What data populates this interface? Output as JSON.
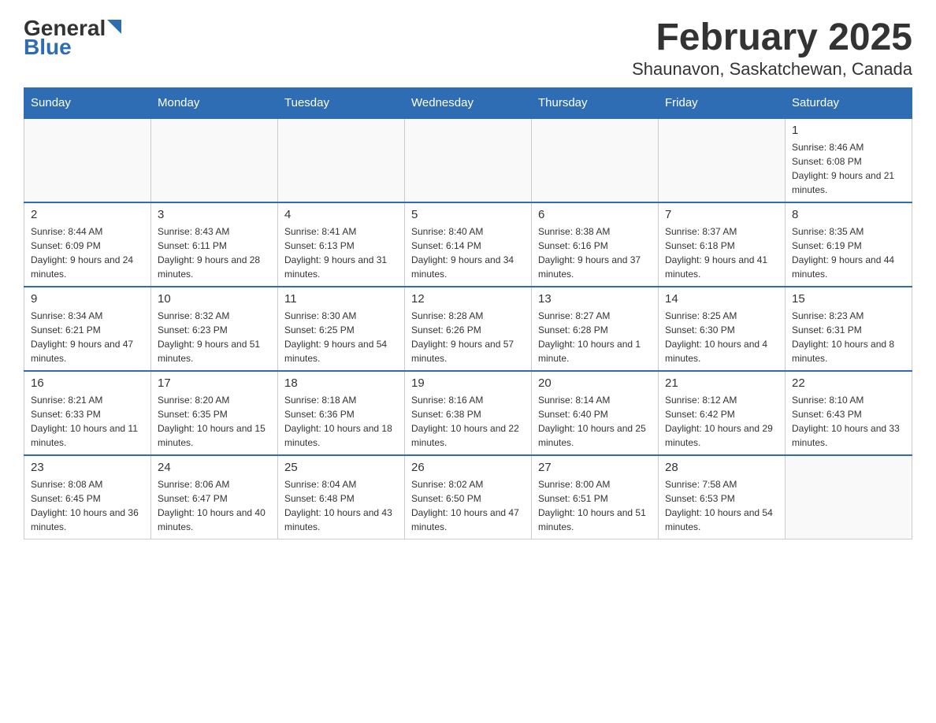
{
  "header": {
    "logo_general": "General",
    "logo_blue": "Blue",
    "title": "February 2025",
    "subtitle": "Shaunavon, Saskatchewan, Canada"
  },
  "days_of_week": [
    "Sunday",
    "Monday",
    "Tuesday",
    "Wednesday",
    "Thursday",
    "Friday",
    "Saturday"
  ],
  "weeks": [
    {
      "days": [
        {
          "num": "",
          "info": ""
        },
        {
          "num": "",
          "info": ""
        },
        {
          "num": "",
          "info": ""
        },
        {
          "num": "",
          "info": ""
        },
        {
          "num": "",
          "info": ""
        },
        {
          "num": "",
          "info": ""
        },
        {
          "num": "1",
          "info": "Sunrise: 8:46 AM\nSunset: 6:08 PM\nDaylight: 9 hours and 21 minutes."
        }
      ]
    },
    {
      "days": [
        {
          "num": "2",
          "info": "Sunrise: 8:44 AM\nSunset: 6:09 PM\nDaylight: 9 hours and 24 minutes."
        },
        {
          "num": "3",
          "info": "Sunrise: 8:43 AM\nSunset: 6:11 PM\nDaylight: 9 hours and 28 minutes."
        },
        {
          "num": "4",
          "info": "Sunrise: 8:41 AM\nSunset: 6:13 PM\nDaylight: 9 hours and 31 minutes."
        },
        {
          "num": "5",
          "info": "Sunrise: 8:40 AM\nSunset: 6:14 PM\nDaylight: 9 hours and 34 minutes."
        },
        {
          "num": "6",
          "info": "Sunrise: 8:38 AM\nSunset: 6:16 PM\nDaylight: 9 hours and 37 minutes."
        },
        {
          "num": "7",
          "info": "Sunrise: 8:37 AM\nSunset: 6:18 PM\nDaylight: 9 hours and 41 minutes."
        },
        {
          "num": "8",
          "info": "Sunrise: 8:35 AM\nSunset: 6:19 PM\nDaylight: 9 hours and 44 minutes."
        }
      ]
    },
    {
      "days": [
        {
          "num": "9",
          "info": "Sunrise: 8:34 AM\nSunset: 6:21 PM\nDaylight: 9 hours and 47 minutes."
        },
        {
          "num": "10",
          "info": "Sunrise: 8:32 AM\nSunset: 6:23 PM\nDaylight: 9 hours and 51 minutes."
        },
        {
          "num": "11",
          "info": "Sunrise: 8:30 AM\nSunset: 6:25 PM\nDaylight: 9 hours and 54 minutes."
        },
        {
          "num": "12",
          "info": "Sunrise: 8:28 AM\nSunset: 6:26 PM\nDaylight: 9 hours and 57 minutes."
        },
        {
          "num": "13",
          "info": "Sunrise: 8:27 AM\nSunset: 6:28 PM\nDaylight: 10 hours and 1 minute."
        },
        {
          "num": "14",
          "info": "Sunrise: 8:25 AM\nSunset: 6:30 PM\nDaylight: 10 hours and 4 minutes."
        },
        {
          "num": "15",
          "info": "Sunrise: 8:23 AM\nSunset: 6:31 PM\nDaylight: 10 hours and 8 minutes."
        }
      ]
    },
    {
      "days": [
        {
          "num": "16",
          "info": "Sunrise: 8:21 AM\nSunset: 6:33 PM\nDaylight: 10 hours and 11 minutes."
        },
        {
          "num": "17",
          "info": "Sunrise: 8:20 AM\nSunset: 6:35 PM\nDaylight: 10 hours and 15 minutes."
        },
        {
          "num": "18",
          "info": "Sunrise: 8:18 AM\nSunset: 6:36 PM\nDaylight: 10 hours and 18 minutes."
        },
        {
          "num": "19",
          "info": "Sunrise: 8:16 AM\nSunset: 6:38 PM\nDaylight: 10 hours and 22 minutes."
        },
        {
          "num": "20",
          "info": "Sunrise: 8:14 AM\nSunset: 6:40 PM\nDaylight: 10 hours and 25 minutes."
        },
        {
          "num": "21",
          "info": "Sunrise: 8:12 AM\nSunset: 6:42 PM\nDaylight: 10 hours and 29 minutes."
        },
        {
          "num": "22",
          "info": "Sunrise: 8:10 AM\nSunset: 6:43 PM\nDaylight: 10 hours and 33 minutes."
        }
      ]
    },
    {
      "days": [
        {
          "num": "23",
          "info": "Sunrise: 8:08 AM\nSunset: 6:45 PM\nDaylight: 10 hours and 36 minutes."
        },
        {
          "num": "24",
          "info": "Sunrise: 8:06 AM\nSunset: 6:47 PM\nDaylight: 10 hours and 40 minutes."
        },
        {
          "num": "25",
          "info": "Sunrise: 8:04 AM\nSunset: 6:48 PM\nDaylight: 10 hours and 43 minutes."
        },
        {
          "num": "26",
          "info": "Sunrise: 8:02 AM\nSunset: 6:50 PM\nDaylight: 10 hours and 47 minutes."
        },
        {
          "num": "27",
          "info": "Sunrise: 8:00 AM\nSunset: 6:51 PM\nDaylight: 10 hours and 51 minutes."
        },
        {
          "num": "28",
          "info": "Sunrise: 7:58 AM\nSunset: 6:53 PM\nDaylight: 10 hours and 54 minutes."
        },
        {
          "num": "",
          "info": ""
        }
      ]
    }
  ]
}
